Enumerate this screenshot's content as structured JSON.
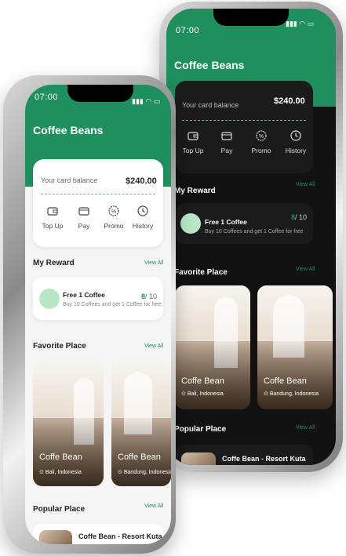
{
  "colors": {
    "brand": "#1f8f5e",
    "dark_bg": "#121212",
    "light_bg": "#f5f5f5"
  },
  "status": {
    "time": "07:00"
  },
  "app": {
    "title": "Coffee Beans"
  },
  "card": {
    "label": "Your card balance",
    "balance": "$240.00"
  },
  "actions": [
    {
      "label": "Top Up",
      "icon": "wallet-icon"
    },
    {
      "label": "Pay",
      "icon": "card-icon"
    },
    {
      "label": "Promo",
      "icon": "promo-icon"
    },
    {
      "label": "History",
      "icon": "clock-icon"
    }
  ],
  "reward": {
    "section": "My Reward",
    "view_all": "View All",
    "title": "Free 1 Coffee",
    "desc": "Buy 10 Coffees and get 1 Coffee for free",
    "count": "8",
    "total": "/ 10"
  },
  "favorite": {
    "section": "Favorite Place",
    "view_all": "View All",
    "places": [
      {
        "name": "Coffe Bean",
        "location": "Bali, Indonesia"
      },
      {
        "name": "Coffe Bean",
        "location": "Bandung, Indonesia"
      }
    ]
  },
  "popular": {
    "section": "Popular Place",
    "view_all": "View All",
    "item": "Coffe Bean - Resort Kuta"
  }
}
